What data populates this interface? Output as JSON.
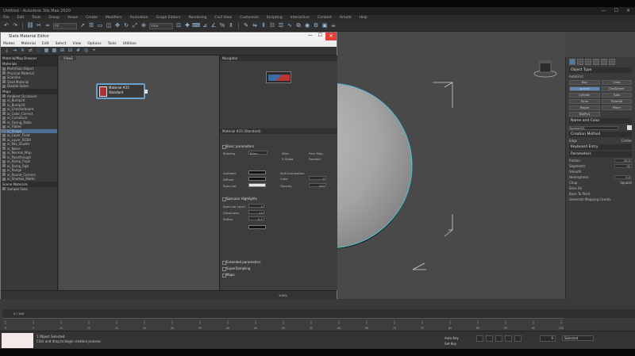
{
  "window": {
    "title": "Untitled - Autodesk 3ds Max 2020",
    "controls": [
      "—",
      "☐",
      "✕"
    ]
  },
  "menubar": {
    "items": [
      "File",
      "Edit",
      "Tools",
      "Group",
      "Views",
      "Create",
      "Modifiers",
      "Animation",
      "Graph Editors",
      "Rendering",
      "Civil View",
      "Customize",
      "Scripting",
      "Interactive",
      "Content",
      "Arnold",
      "Help"
    ]
  },
  "toolbar": {
    "selection_filter": "All",
    "view_select": "View"
  },
  "sme": {
    "title": "Slate Material Editor",
    "controls": {
      "min": "—",
      "max": "☐",
      "close": "✕"
    },
    "menu": [
      "Modes",
      "Material",
      "Edit",
      "Select",
      "View",
      "Options",
      "Tools",
      "Utilities"
    ],
    "browser": {
      "header": "Material/Map Browser",
      "groups": [
        {
          "label": "Materials",
          "items": [
            "Multi/Sub-Object",
            "Physical Material",
            "Scanline",
            "Shell Material",
            "Double Sided"
          ]
        },
        {
          "label": "Maps",
          "items": [
            "Ambient Occlusion",
            "ai_Bump2d",
            "ai_Bump3d",
            "ai_Checkerboard",
            "ai_Color_Correct",
            "ai_Curvature",
            "ai_Facing_Ratio",
            "ai_Flakes",
            "ai_Image",
            "ai_Layer_Float",
            "ai_Layer_RGBA",
            "ai_Mix_Shader",
            "ai_Noise",
            "ai_Normal_Map",
            "ai_Passthrough",
            "ai_Ramp_Float",
            "ai_Ramp_Rgb",
            "ai_Range",
            "ai_Round_Corners",
            "ai_Shadow_Matte"
          ]
        },
        {
          "label": "Scene Materials",
          "items": [
            "Sample Slots"
          ]
        }
      ],
      "selected_item": "ai_Image"
    },
    "view_tab": "View1",
    "node": {
      "line1": "Material #25",
      "line2": "Standard"
    },
    "params": {
      "navigator": "Navigator",
      "material_name": "Material #25  (Standard)",
      "sections": [
        "Basic parameters",
        "Extended parameters",
        "SuperSampling",
        "Maps"
      ],
      "labels": [
        "Shading",
        "Blinn",
        "Wire",
        "2-Sided",
        "Face Map",
        "Faceted",
        "Ambient",
        "Diffuse",
        "Specular",
        "Self-Illumination",
        "Color",
        "Opacity",
        "Specular Highlights",
        "Specular Level",
        "Glossiness",
        "Soften"
      ],
      "values": {
        "self_illum": "0",
        "opacity": "100",
        "spec_level": "0",
        "glossiness": "10",
        "soften": "0.1"
      }
    },
    "status": {
      "zoom": "100%"
    }
  },
  "command_panel": {
    "rollout_object_type": "Object Type",
    "autogrid": "AutoGrid",
    "object_buttons": [
      "Box",
      "Cone",
      "Sphere",
      "GeoSphere",
      "Cylinder",
      "Tube",
      "Torus",
      "Pyramid",
      "Teapot",
      "Plane",
      "TextPlus"
    ],
    "selected_button": "Sphere",
    "rollout_name_color": "Name and Color",
    "object_name": "Sphere001",
    "rollout_creation": "Creation Method",
    "creation_edge": "Edge",
    "creation_center": "Center",
    "rollout_keyboard": "Keyboard Entry",
    "rollout_params": "Parameters",
    "radius_label": "Radius:",
    "radius": "50.0",
    "segments_label": "Segments:",
    "segments": "32",
    "smooth": "Smooth",
    "hemisphere_label": "Hemisphere:",
    "hemisphere": "0.0",
    "chop": "Chop",
    "squash": "Squash",
    "slice_on": "Slice On",
    "base_to_pivot": "Base To Pivot",
    "gen_coords": "Generate Mapping Coords."
  },
  "timeline": {
    "frame": "0 / 100",
    "ticks": [
      "0",
      "5",
      "10",
      "15",
      "20",
      "25",
      "30",
      "35",
      "40",
      "45",
      "50",
      "55",
      "60",
      "65",
      "70",
      "75",
      "80",
      "85",
      "90",
      "95",
      "100"
    ]
  },
  "statusbar": {
    "selection": "1 Object Selected",
    "prompt": "Click and drag to begin creation process",
    "auto_key": "Auto Key",
    "set_key": "Set Key",
    "selected": "Selected",
    "frame_value": "0"
  },
  "colors": {
    "accent": "#4b6f95",
    "close": "#e3403b",
    "viewport_bg": "#494949"
  }
}
